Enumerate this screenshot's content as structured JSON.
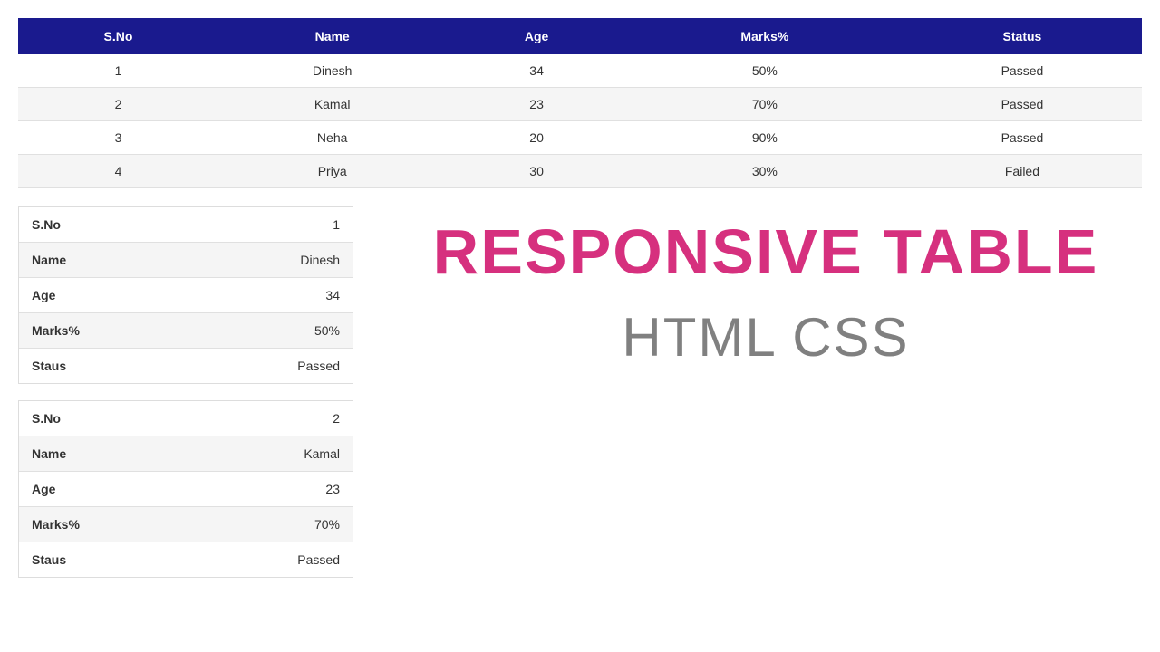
{
  "table": {
    "headers": [
      "S.No",
      "Name",
      "Age",
      "Marks%",
      "Status"
    ],
    "rows": [
      {
        "sno": "1",
        "name": "Dinesh",
        "age": "34",
        "marks": "50%",
        "status": "Passed"
      },
      {
        "sno": "2",
        "name": "Kamal",
        "age": "23",
        "marks": "70%",
        "status": "Passed"
      },
      {
        "sno": "3",
        "name": "Neha",
        "age": "20",
        "marks": "90%",
        "status": "Passed"
      },
      {
        "sno": "4",
        "name": "Priya",
        "age": "30",
        "marks": "30%",
        "status": "Failed"
      }
    ]
  },
  "cards": {
    "labels": {
      "sno": "S.No",
      "name": "Name",
      "age": "Age",
      "marks": "Marks%",
      "status": "Staus"
    },
    "items": [
      {
        "sno": "1",
        "name": "Dinesh",
        "age": "34",
        "marks": "50%",
        "status": "Passed"
      },
      {
        "sno": "2",
        "name": "Kamal",
        "age": "23",
        "marks": "70%",
        "status": "Passed"
      }
    ]
  },
  "titles": {
    "main": "RESPONSIVE TABLE",
    "sub": "HTML CSS"
  }
}
